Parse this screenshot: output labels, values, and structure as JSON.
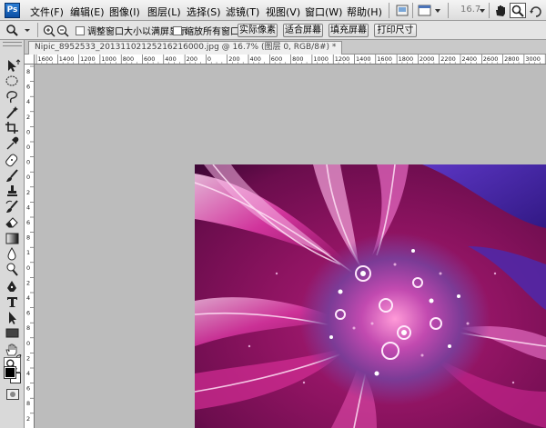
{
  "app": {
    "logo": "Ps"
  },
  "menu": {
    "items": [
      "文件(F)",
      "编辑(E)",
      "图像(I)",
      "图层(L)",
      "选择(S)",
      "滤镜(T)",
      "视图(V)",
      "窗口(W)",
      "帮助(H)"
    ]
  },
  "menubar_right": {
    "zoom": "16.7"
  },
  "options": {
    "resize_windows_label": "调整窗口大小以满屏显示",
    "zoom_all_windows_label": "缩放所有窗口",
    "actual_pixels": "实际像素",
    "fit_screen": "适合屏幕",
    "fill_screen": "填充屏幕",
    "print_size": "打印尺寸"
  },
  "document": {
    "tab_title": "Nipic_8952533_20131102125216216000.jpg @ 16.7% (图层 0, RGB/8#) *"
  },
  "ruler": {
    "h_labels": [
      "1600",
      "1400",
      "1200",
      "1000",
      "800",
      "600",
      "400",
      "200",
      "0",
      "200",
      "400",
      "600",
      "800",
      "1000",
      "1200",
      "1400",
      "1600",
      "1800",
      "2000",
      "2200",
      "2400",
      "2600",
      "2800",
      "3000",
      "3200"
    ],
    "v_labels": [
      "8",
      "6",
      "4",
      "2",
      "0",
      "0",
      "0",
      "0",
      "2",
      "4",
      "6",
      "8",
      "1",
      "0",
      "2",
      "4",
      "6",
      "8",
      "0",
      "2",
      "4",
      "6",
      "8",
      "2"
    ]
  },
  "tools": [
    "move-tool-icon",
    "marquee-tool-icon",
    "lasso-tool-icon",
    "magic-wand-tool-icon",
    "crop-tool-icon",
    "eyedropper-tool-icon",
    "healing-brush-tool-icon",
    "brush-tool-icon",
    "clone-stamp-tool-icon",
    "history-brush-tool-icon",
    "eraser-tool-icon",
    "gradient-tool-icon",
    "blur-tool-icon",
    "dodge-tool-icon",
    "pen-tool-icon",
    "type-tool-icon",
    "path-selection-tool-icon",
    "rectangle-tool-icon",
    "hand-tool-icon",
    "zoom-tool-icon"
  ],
  "colors": {
    "foreground": "#000000",
    "background": "#ffffff",
    "accent": "#0b4ea2"
  }
}
